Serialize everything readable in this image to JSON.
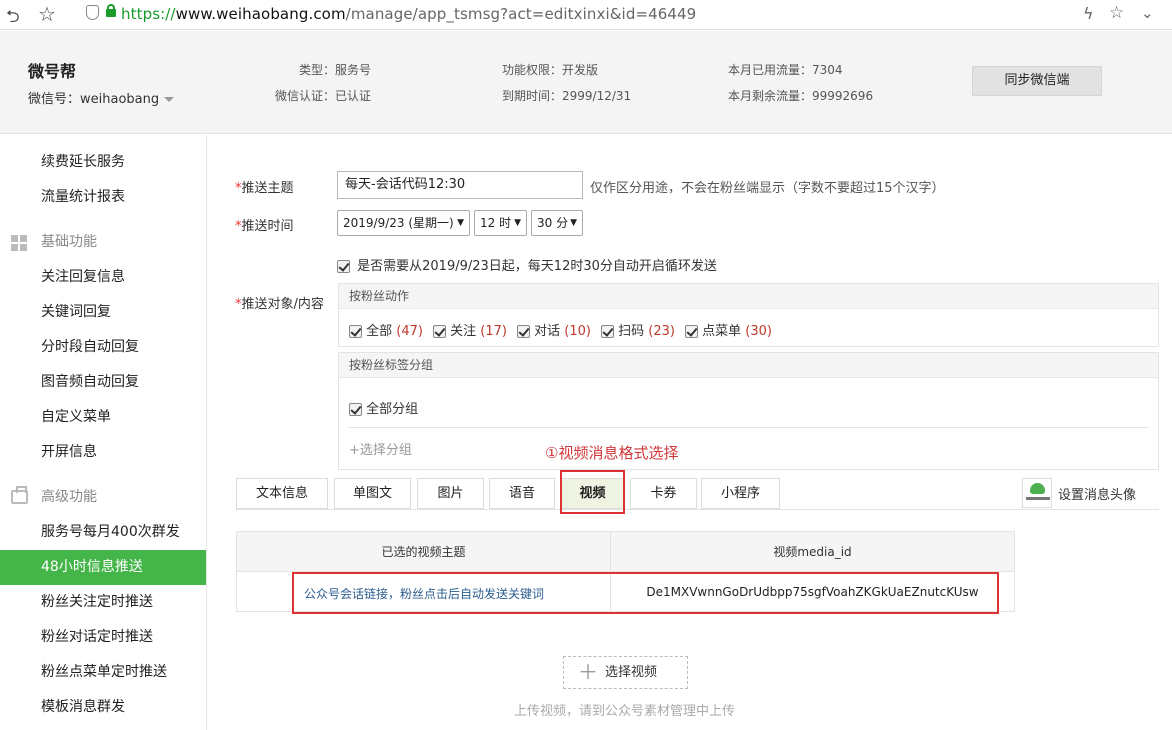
{
  "browser": {
    "url_scheme": "https://",
    "url_host": "www.weihaobang.com",
    "url_path": "/manage/app_tsmsg?act=editxinxi&id=46449"
  },
  "header": {
    "brand": "微号帮",
    "wx_account": "微信号：weihaobang",
    "type": "类型：服务号",
    "verify": "微信认证：已认证",
    "permission": "功能权限：开发版",
    "expire": "到期时间：2999/12/31",
    "used_flow": "本月已用流量：7304",
    "remain_flow": "本月剩余流量：99992696",
    "sync_button": "同步微信端"
  },
  "sidebar": {
    "items_top": [
      "续费延长服务",
      "流量统计报表"
    ],
    "group_basic": "基础功能",
    "basic_items": [
      "关注回复信息",
      "关键词回复",
      "分时段自动回复",
      "图音频自动回复",
      "自定义菜单",
      "开屏信息"
    ],
    "group_adv": "高级功能",
    "adv_items": [
      "服务号每月400次群发",
      "48小时信息推送",
      "粉丝关注定时推送",
      "粉丝对话定时推送",
      "粉丝点菜单定时推送",
      "模板消息群发"
    ]
  },
  "form": {
    "topic_label": "推送主题",
    "topic_value": "每天-会话代码12:30",
    "topic_hint": "仅作区分用途，不会在粉丝端显示（字数不要超过15个汉字）",
    "time_label": "推送时间",
    "date_select": "2019/9/23 (星期一)",
    "hour_select": "12 时",
    "minute_select": "30 分",
    "loop_text": "是否需要从2019/9/23日起，每天12时30分自动开启循环发送",
    "target_label": "推送对象/内容",
    "action_panel_title": "按粉丝动作",
    "actions": [
      {
        "label": "全部",
        "count": "(47)"
      },
      {
        "label": "关注",
        "count": "(17)"
      },
      {
        "label": "对话",
        "count": "(10)"
      },
      {
        "label": "扫码",
        "count": "(23)"
      },
      {
        "label": "点菜单",
        "count": "(30)"
      }
    ],
    "tag_panel_title": "按粉丝标签分组",
    "all_groups": "全部分组",
    "add_group": "+选择分组"
  },
  "annotation": "①视频消息格式选择",
  "tabs": [
    "文本信息",
    "单图文",
    "图片",
    "语音",
    "视频",
    "卡券",
    "小程序"
  ],
  "active_tab": "视频",
  "avatar_label": "设置消息头像",
  "video_table": {
    "headers": [
      "已选的视频主题",
      "视频media_id"
    ],
    "row": {
      "topic": "公众号会话链接，粉丝点击后自动发送关键词",
      "media_id": "De1MXVwnnGoDrUdbpp75sgfVoahZKGkUaEZnutcKUsw"
    }
  },
  "select_video_button": "选择视频",
  "upload_hint": "上传视频，请到公众号素材管理中上传",
  "colors": {
    "accent": "#44b549",
    "highlight": "#d33333",
    "required": "#ee3333"
  }
}
